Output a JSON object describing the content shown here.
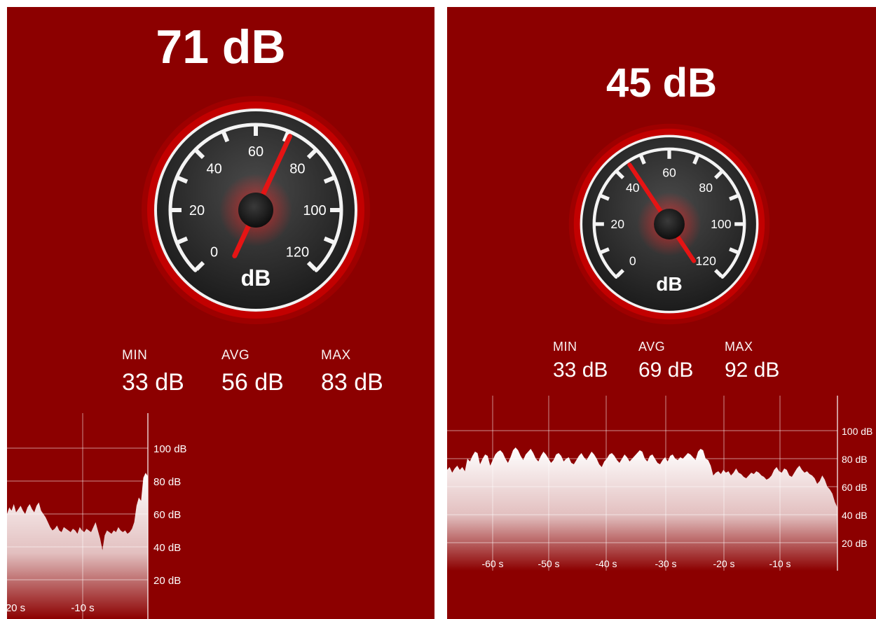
{
  "screens": [
    {
      "reading": "71 dB",
      "level_db": 71,
      "gauge": {
        "scale": [
          "0",
          "20",
          "40",
          "60",
          "80",
          "100",
          "120"
        ],
        "unit": "dB",
        "min": 0,
        "max": 120
      },
      "stats": [
        {
          "label": "MIN",
          "value": "33 dB"
        },
        {
          "label": "AVG",
          "value": "56 dB"
        },
        {
          "label": "MAX",
          "value": "83 dB"
        }
      ],
      "history": {
        "y_labels": [
          "100 dB",
          "80 dB",
          "60 dB",
          "40 dB",
          "20 dB"
        ],
        "x_labels": [
          "20 s",
          "-10 s"
        ],
        "values_db": [
          60,
          64,
          62,
          66,
          61,
          63,
          65,
          62,
          60,
          64,
          66,
          63,
          61,
          65,
          67,
          62,
          60,
          58,
          55,
          52,
          50,
          51,
          53,
          50,
          49,
          52,
          51,
          50,
          49,
          51,
          50,
          48,
          52,
          50,
          49,
          51,
          50,
          49,
          52,
          55,
          50,
          45,
          38,
          47,
          50,
          49,
          48,
          50,
          49,
          52,
          50,
          49,
          50,
          48,
          49,
          51,
          55,
          65,
          70,
          68,
          82,
          85,
          83
        ]
      },
      "colors": {
        "background": "#8c0000",
        "needle": "#e51414",
        "gauge_face": "#2a2a2a",
        "rim": "#c20000"
      }
    },
    {
      "reading": "45 dB",
      "level_db": 45,
      "gauge": {
        "scale": [
          "0",
          "20",
          "40",
          "60",
          "80",
          "100",
          "120"
        ],
        "unit": "dB",
        "min": 0,
        "max": 120
      },
      "stats": [
        {
          "label": "MIN",
          "value": "33 dB"
        },
        {
          "label": "AVG",
          "value": "69 dB"
        },
        {
          "label": "MAX",
          "value": "92 dB"
        }
      ],
      "history": {
        "y_labels": [
          "100 dB",
          "80 dB",
          "60 dB",
          "40 dB",
          "20 dB"
        ],
        "x_labels": [
          "-60 s",
          "-50 s",
          "-40 s",
          "-30 s",
          "-20 s",
          "-10 s"
        ],
        "values_db": [
          72,
          74,
          70,
          73,
          75,
          72,
          74,
          71,
          80,
          78,
          82,
          85,
          84,
          76,
          80,
          83,
          82,
          75,
          79,
          83,
          85,
          86,
          84,
          80,
          77,
          81,
          86,
          88,
          86,
          82,
          79,
          83,
          85,
          87,
          84,
          80,
          78,
          82,
          85,
          83,
          80,
          77,
          79,
          83,
          84,
          82,
          78,
          80,
          81,
          77,
          76,
          79,
          82,
          84,
          81,
          79,
          82,
          85,
          83,
          80,
          76,
          74,
          78,
          80,
          83,
          84,
          82,
          79,
          77,
          80,
          83,
          81,
          78,
          80,
          82,
          84,
          86,
          85,
          80,
          78,
          82,
          83,
          80,
          77,
          76,
          79,
          81,
          78,
          82,
          83,
          80,
          79,
          81,
          80,
          82,
          84,
          83,
          81,
          79,
          85,
          87,
          86,
          80,
          79,
          75,
          68,
          70,
          71,
          69,
          72,
          70,
          71,
          68,
          70,
          73,
          70,
          69,
          67,
          66,
          68,
          70,
          69,
          71,
          70,
          68,
          67,
          65,
          66,
          68,
          72,
          74,
          71,
          70,
          73,
          72,
          68,
          67,
          70,
          73,
          75,
          72,
          70,
          71,
          69,
          68,
          66,
          62,
          64,
          68,
          65,
          60,
          58,
          55,
          49,
          45
        ]
      },
      "colors": {
        "background": "#8c0000",
        "needle": "#e51414",
        "gauge_face": "#2a2a2a",
        "rim": "#c20000"
      }
    }
  ]
}
